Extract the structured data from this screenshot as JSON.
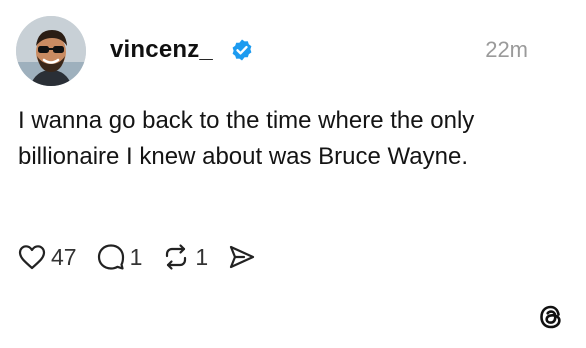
{
  "post": {
    "username": "vincenz_",
    "verified": true,
    "timestamp": "22m",
    "text": "I wanna go back to the time where the only billionaire I knew about was Bruce Wayne.",
    "likes": "47",
    "replies": "1",
    "reposts": "1"
  },
  "icons": {
    "like": "heart-icon",
    "reply": "speech-bubble-icon",
    "repost": "repost-icon",
    "share": "send-icon",
    "verified": "verified-badge-icon",
    "brand": "threads-logo"
  },
  "colors": {
    "verified_blue": "#1d9bf0",
    "text": "#141414",
    "muted": "#9a9a9a"
  }
}
